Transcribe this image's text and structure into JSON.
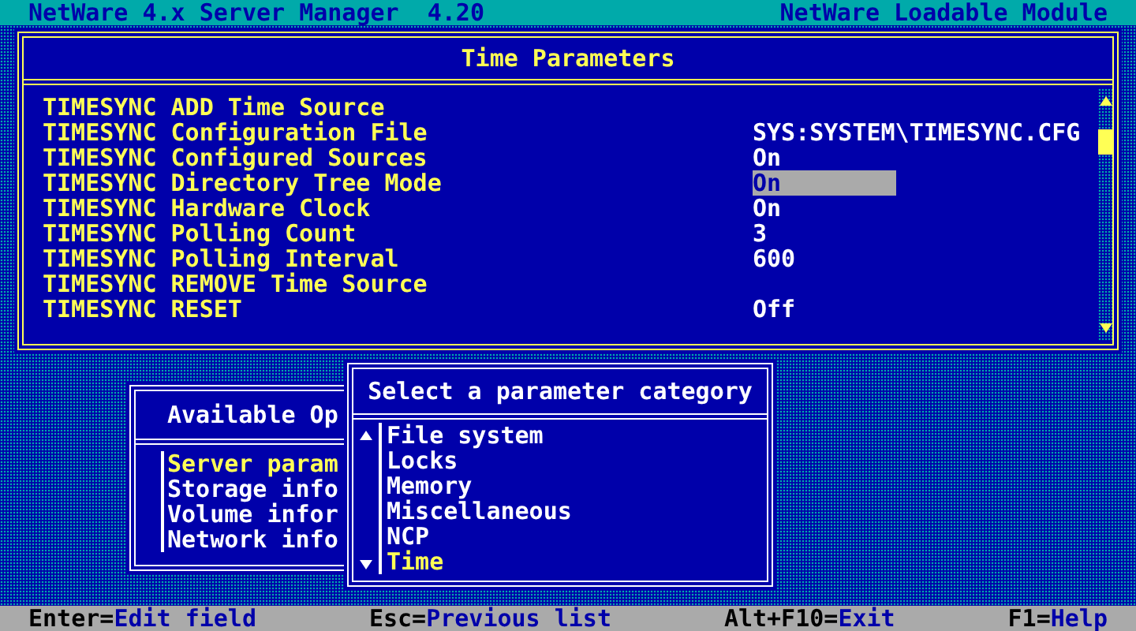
{
  "header": {
    "title": "NetWare 4.x Server Manager  4.20",
    "module": "NetWare Loadable Module"
  },
  "time_parameters": {
    "title": "Time Parameters",
    "rows": [
      {
        "label": "TIMESYNC ADD Time Source",
        "selected": false
      },
      {
        "label": "TIMESYNC Configuration File",
        "value": "SYS:SYSTEM\\TIMESYNC.CFG",
        "selected": false
      },
      {
        "label": "TIMESYNC Configured Sources",
        "value": "On",
        "selected": false
      },
      {
        "label": "TIMESYNC Directory Tree Mode",
        "value": "On",
        "selected": true
      },
      {
        "label": "TIMESYNC Hardware Clock",
        "value": "On",
        "selected": false
      },
      {
        "label": "TIMESYNC Polling Count",
        "value": "3",
        "selected": false
      },
      {
        "label": "TIMESYNC Polling Interval",
        "value": "600",
        "selected": false
      },
      {
        "label": "TIMESYNC REMOVE Time Source",
        "selected": false
      },
      {
        "label": "TIMESYNC RESET",
        "value": "Off",
        "selected": false
      }
    ]
  },
  "available_options": {
    "title": "Available Op",
    "items": [
      {
        "label": "Server param",
        "selected": true
      },
      {
        "label": "Storage info",
        "selected": false
      },
      {
        "label": "Volume infor",
        "selected": false
      },
      {
        "label": "Network info",
        "selected": false
      }
    ]
  },
  "category_menu": {
    "title": "Select a parameter category",
    "items": [
      {
        "label": "File system",
        "selected": false
      },
      {
        "label": "Locks",
        "selected": false
      },
      {
        "label": "Memory",
        "selected": false
      },
      {
        "label": "Miscellaneous",
        "selected": false
      },
      {
        "label": "NCP",
        "selected": false
      },
      {
        "label": "Time",
        "selected": true
      }
    ]
  },
  "status_bar": {
    "hints": [
      {
        "key": "Enter=",
        "action": "Edit field"
      },
      {
        "key": "Esc=",
        "action": "Previous list"
      },
      {
        "key": "Alt+F10=",
        "action": "Exit"
      },
      {
        "key": "F1=",
        "action": "Help"
      }
    ]
  }
}
